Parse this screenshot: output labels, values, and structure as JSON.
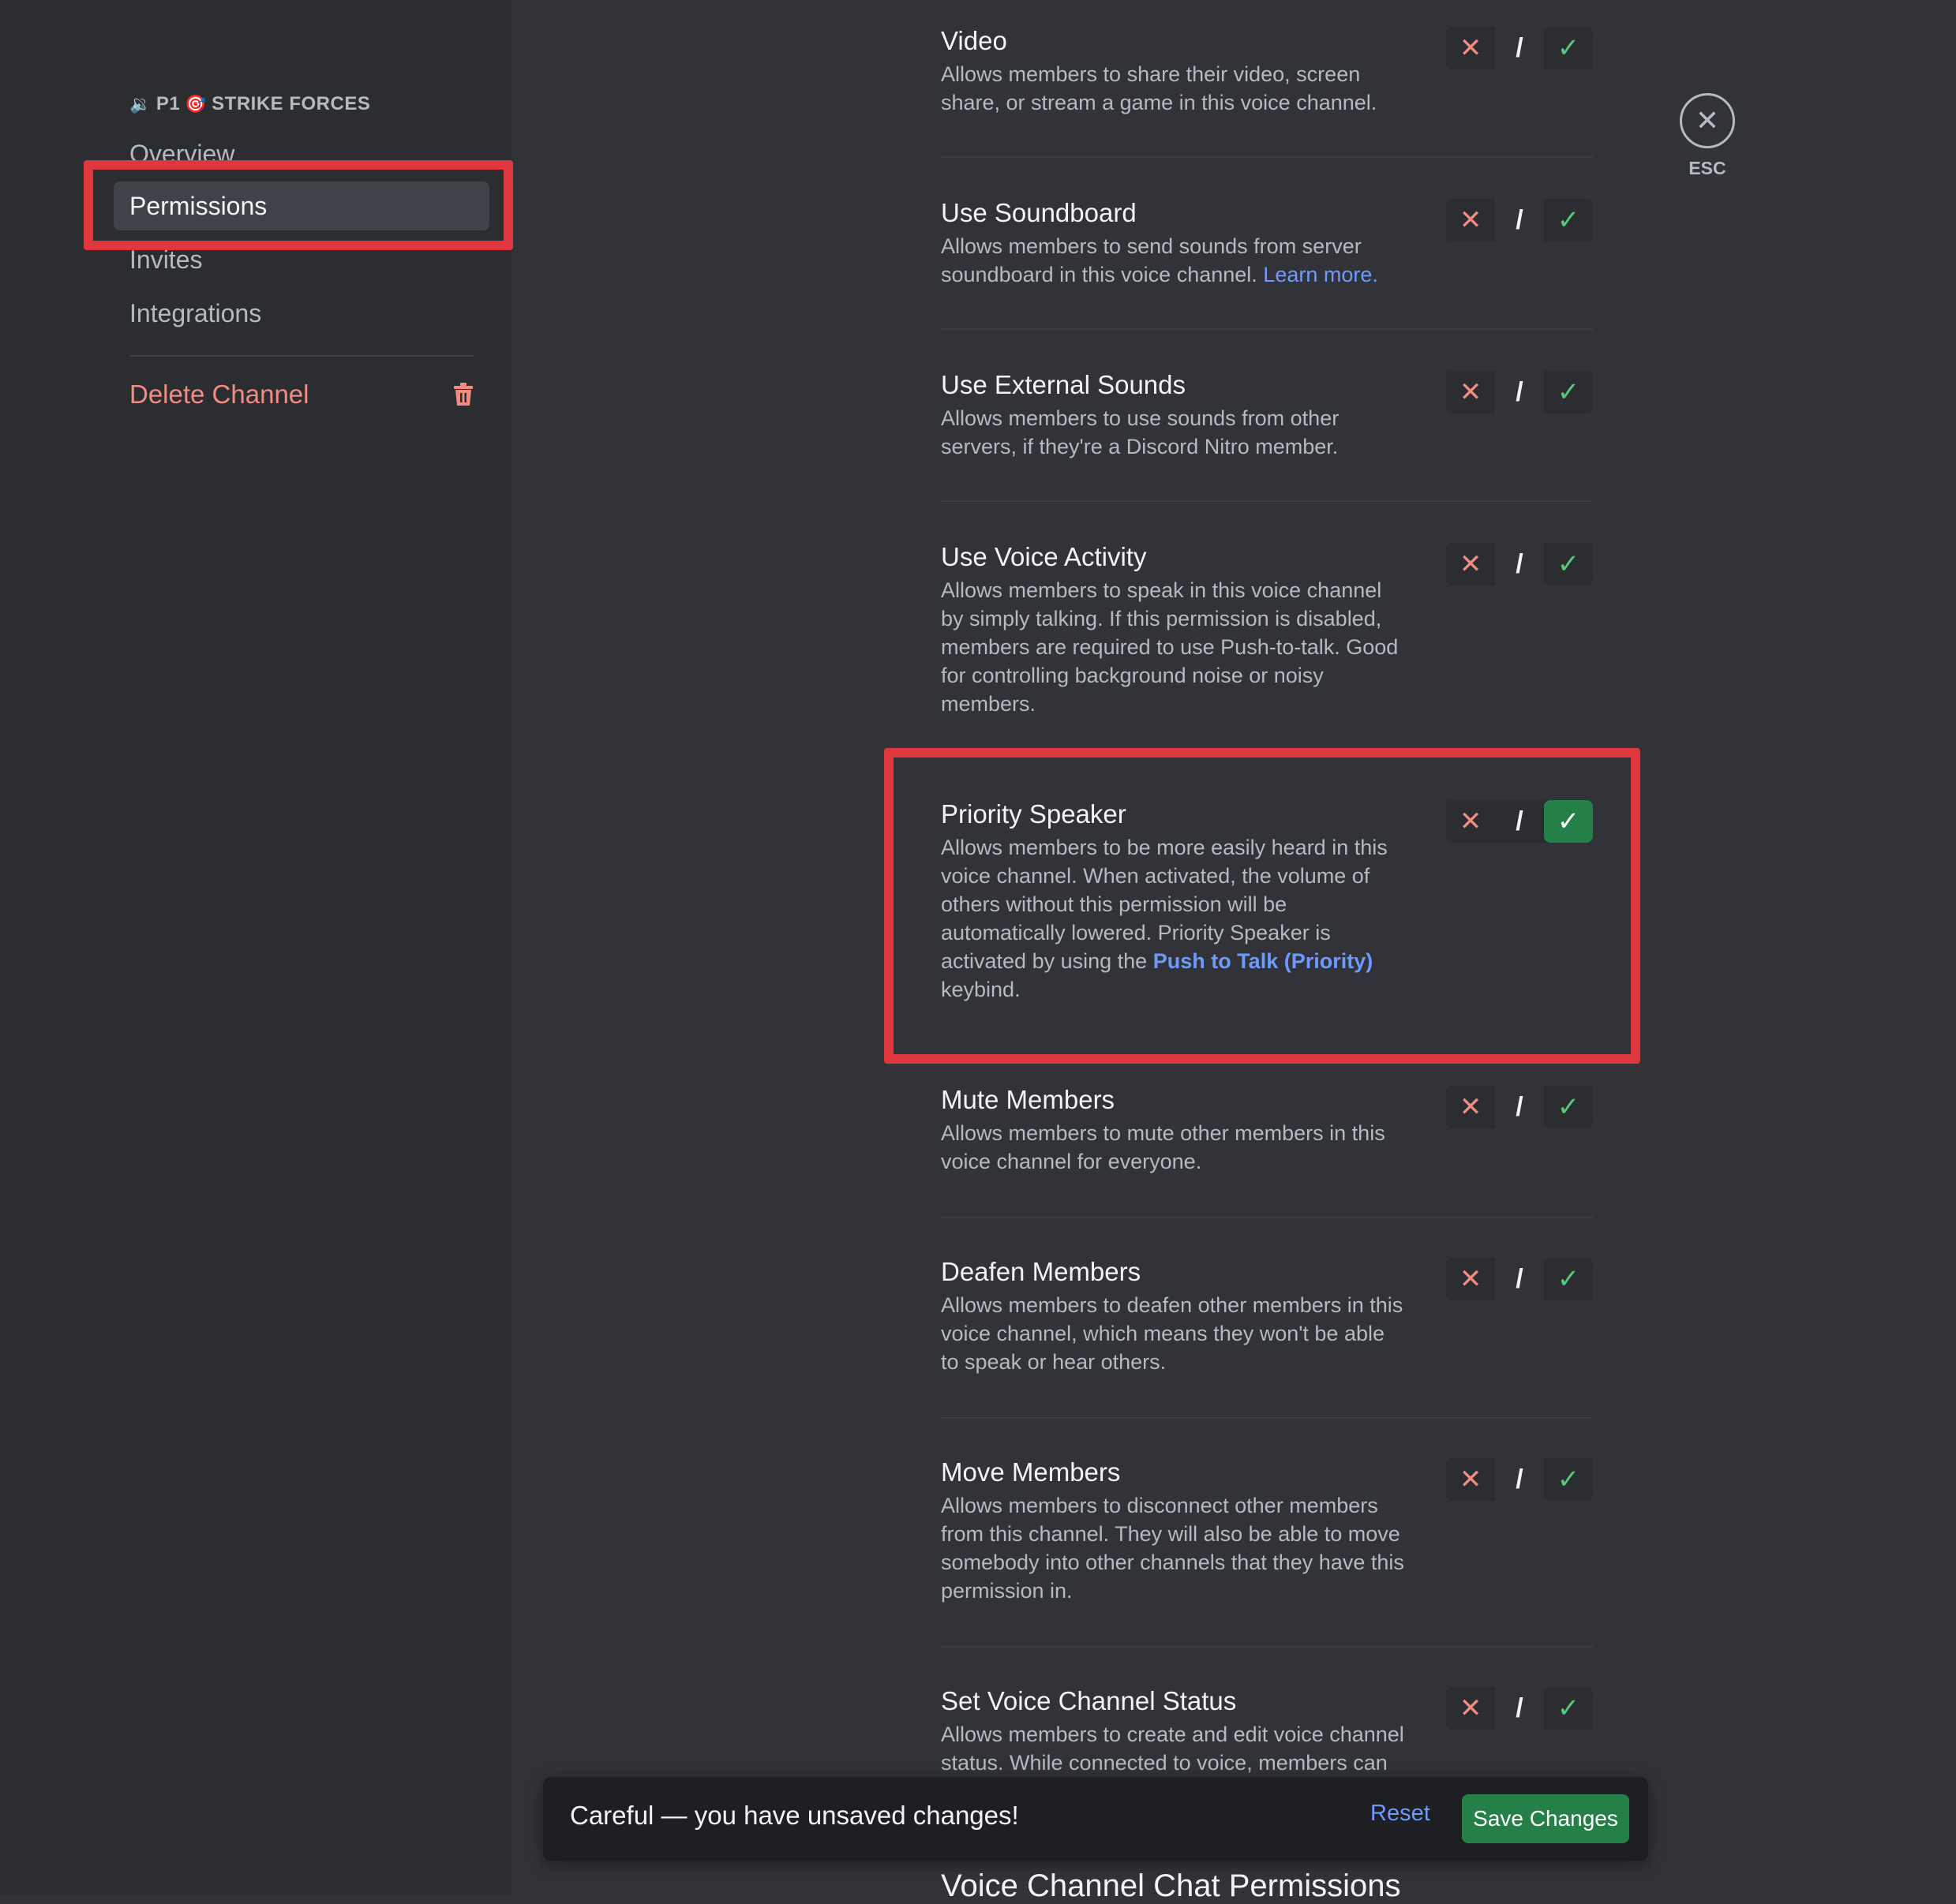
{
  "sidebar": {
    "header_icon": "🔉",
    "header_prefix": "P1",
    "header_emoji": "🎯",
    "header_name": "STRIKE FORCES",
    "items": [
      {
        "label": "Overview"
      },
      {
        "label": "Permissions"
      },
      {
        "label": "Invites"
      },
      {
        "label": "Integrations"
      }
    ],
    "delete_label": "Delete Channel"
  },
  "close": {
    "icon": "✕",
    "label": "ESC"
  },
  "toggle_glyphs": {
    "deny": "✕",
    "neutral": "/",
    "allow": "✓"
  },
  "permissions": [
    {
      "title": "Video",
      "desc": "Allows members to share their video, screen share, or stream a game in this voice channel.",
      "state": "neutral"
    },
    {
      "title": "Use Soundboard",
      "desc": "Allows members to send sounds from server soundboard in this voice channel.",
      "link": "Learn more.",
      "state": "neutral"
    },
    {
      "title": "Use External Sounds",
      "desc": "Allows members to use sounds from other servers, if they're a Discord Nitro member.",
      "state": "neutral"
    },
    {
      "title": "Use Voice Activity",
      "desc": "Allows members to speak in this voice channel by simply talking. If this permission is disabled, members are required to use Push-to-talk. Good for controlling background noise or noisy members.",
      "state": "neutral"
    },
    {
      "title": "Priority Speaker",
      "desc_before": "Allows members to be more easily heard in this voice channel. When activated, the volume of others without this permission will be automatically lowered. Priority Speaker is activated by using the",
      "link": "Push to Talk (Priority)",
      "desc_after": "keybind.",
      "state": "allow"
    },
    {
      "title": "Mute Members",
      "desc": "Allows members to mute other members in this voice channel for everyone.",
      "state": "neutral"
    },
    {
      "title": "Deafen Members",
      "desc": "Allows members to deafen other members in this voice channel, which means they won't be able to speak or hear others.",
      "state": "neutral"
    },
    {
      "title": "Move Members",
      "desc": "Allows members to disconnect other members from this channel. They will also be able to move somebody into other channels that they have this permission in.",
      "state": "neutral"
    },
    {
      "title": "Set Voice Channel Status",
      "desc": "Allows members to create and edit voice channel status. While connected to voice, members can",
      "state": "neutral"
    }
  ],
  "notice": {
    "message": "Careful — you have unsaved changes!",
    "reset_label": "Reset",
    "save_label": "Save Changes"
  },
  "next_section_heading": "Voice Channel Chat Permissions",
  "colors": {
    "highlight": "#e0363e",
    "allow_active": "#248046",
    "link": "#6e9aff"
  }
}
